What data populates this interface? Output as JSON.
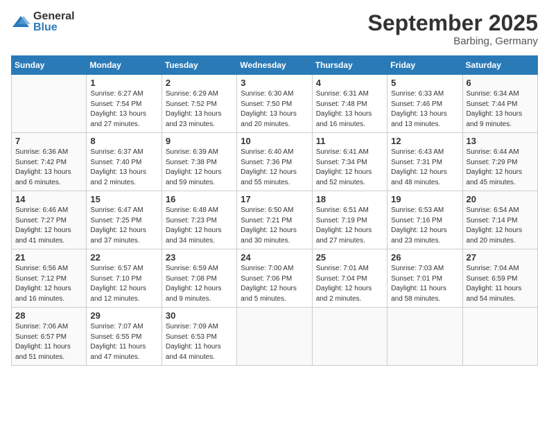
{
  "logo": {
    "text_general": "General",
    "text_blue": "Blue"
  },
  "header": {
    "month": "September 2025",
    "location": "Barbing, Germany"
  },
  "weekdays": [
    "Sunday",
    "Monday",
    "Tuesday",
    "Wednesday",
    "Thursday",
    "Friday",
    "Saturday"
  ],
  "weeks": [
    [
      {
        "day": "",
        "info": ""
      },
      {
        "day": "1",
        "info": "Sunrise: 6:27 AM\nSunset: 7:54 PM\nDaylight: 13 hours\nand 27 minutes."
      },
      {
        "day": "2",
        "info": "Sunrise: 6:29 AM\nSunset: 7:52 PM\nDaylight: 13 hours\nand 23 minutes."
      },
      {
        "day": "3",
        "info": "Sunrise: 6:30 AM\nSunset: 7:50 PM\nDaylight: 13 hours\nand 20 minutes."
      },
      {
        "day": "4",
        "info": "Sunrise: 6:31 AM\nSunset: 7:48 PM\nDaylight: 13 hours\nand 16 minutes."
      },
      {
        "day": "5",
        "info": "Sunrise: 6:33 AM\nSunset: 7:46 PM\nDaylight: 13 hours\nand 13 minutes."
      },
      {
        "day": "6",
        "info": "Sunrise: 6:34 AM\nSunset: 7:44 PM\nDaylight: 13 hours\nand 9 minutes."
      }
    ],
    [
      {
        "day": "7",
        "info": "Sunrise: 6:36 AM\nSunset: 7:42 PM\nDaylight: 13 hours\nand 6 minutes."
      },
      {
        "day": "8",
        "info": "Sunrise: 6:37 AM\nSunset: 7:40 PM\nDaylight: 13 hours\nand 2 minutes."
      },
      {
        "day": "9",
        "info": "Sunrise: 6:39 AM\nSunset: 7:38 PM\nDaylight: 12 hours\nand 59 minutes."
      },
      {
        "day": "10",
        "info": "Sunrise: 6:40 AM\nSunset: 7:36 PM\nDaylight: 12 hours\nand 55 minutes."
      },
      {
        "day": "11",
        "info": "Sunrise: 6:41 AM\nSunset: 7:34 PM\nDaylight: 12 hours\nand 52 minutes."
      },
      {
        "day": "12",
        "info": "Sunrise: 6:43 AM\nSunset: 7:31 PM\nDaylight: 12 hours\nand 48 minutes."
      },
      {
        "day": "13",
        "info": "Sunrise: 6:44 AM\nSunset: 7:29 PM\nDaylight: 12 hours\nand 45 minutes."
      }
    ],
    [
      {
        "day": "14",
        "info": "Sunrise: 6:46 AM\nSunset: 7:27 PM\nDaylight: 12 hours\nand 41 minutes."
      },
      {
        "day": "15",
        "info": "Sunrise: 6:47 AM\nSunset: 7:25 PM\nDaylight: 12 hours\nand 37 minutes."
      },
      {
        "day": "16",
        "info": "Sunrise: 6:48 AM\nSunset: 7:23 PM\nDaylight: 12 hours\nand 34 minutes."
      },
      {
        "day": "17",
        "info": "Sunrise: 6:50 AM\nSunset: 7:21 PM\nDaylight: 12 hours\nand 30 minutes."
      },
      {
        "day": "18",
        "info": "Sunrise: 6:51 AM\nSunset: 7:19 PM\nDaylight: 12 hours\nand 27 minutes."
      },
      {
        "day": "19",
        "info": "Sunrise: 6:53 AM\nSunset: 7:16 PM\nDaylight: 12 hours\nand 23 minutes."
      },
      {
        "day": "20",
        "info": "Sunrise: 6:54 AM\nSunset: 7:14 PM\nDaylight: 12 hours\nand 20 minutes."
      }
    ],
    [
      {
        "day": "21",
        "info": "Sunrise: 6:56 AM\nSunset: 7:12 PM\nDaylight: 12 hours\nand 16 minutes."
      },
      {
        "day": "22",
        "info": "Sunrise: 6:57 AM\nSunset: 7:10 PM\nDaylight: 12 hours\nand 12 minutes."
      },
      {
        "day": "23",
        "info": "Sunrise: 6:59 AM\nSunset: 7:08 PM\nDaylight: 12 hours\nand 9 minutes."
      },
      {
        "day": "24",
        "info": "Sunrise: 7:00 AM\nSunset: 7:06 PM\nDaylight: 12 hours\nand 5 minutes."
      },
      {
        "day": "25",
        "info": "Sunrise: 7:01 AM\nSunset: 7:04 PM\nDaylight: 12 hours\nand 2 minutes."
      },
      {
        "day": "26",
        "info": "Sunrise: 7:03 AM\nSunset: 7:01 PM\nDaylight: 11 hours\nand 58 minutes."
      },
      {
        "day": "27",
        "info": "Sunrise: 7:04 AM\nSunset: 6:59 PM\nDaylight: 11 hours\nand 54 minutes."
      }
    ],
    [
      {
        "day": "28",
        "info": "Sunrise: 7:06 AM\nSunset: 6:57 PM\nDaylight: 11 hours\nand 51 minutes."
      },
      {
        "day": "29",
        "info": "Sunrise: 7:07 AM\nSunset: 6:55 PM\nDaylight: 11 hours\nand 47 minutes."
      },
      {
        "day": "30",
        "info": "Sunrise: 7:09 AM\nSunset: 6:53 PM\nDaylight: 11 hours\nand 44 minutes."
      },
      {
        "day": "",
        "info": ""
      },
      {
        "day": "",
        "info": ""
      },
      {
        "day": "",
        "info": ""
      },
      {
        "day": "",
        "info": ""
      }
    ]
  ]
}
